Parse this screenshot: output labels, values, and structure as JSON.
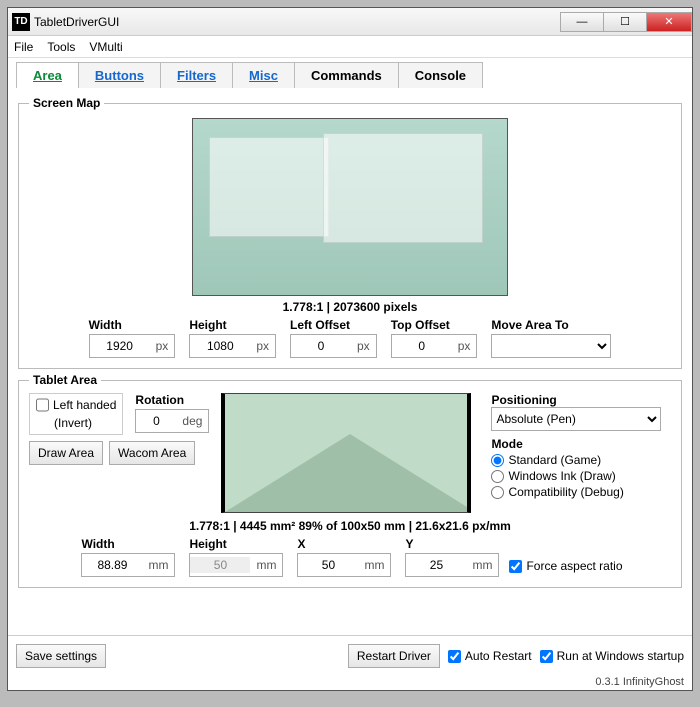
{
  "titlebar": {
    "icon": "TD",
    "title": "TabletDriverGUI"
  },
  "menu": {
    "file": "File",
    "tools": "Tools",
    "vmulti": "VMulti"
  },
  "tabs": {
    "area": "Area",
    "buttons": "Buttons",
    "filters": "Filters",
    "misc": "Misc",
    "commands": "Commands",
    "console": "Console"
  },
  "screenmap": {
    "legend": "Screen Map",
    "caption": "1.778:1 | 2073600 pixels",
    "width_label": "Width",
    "width": "1920",
    "width_unit": "px",
    "height_label": "Height",
    "height": "1080",
    "height_unit": "px",
    "left_label": "Left Offset",
    "left": "0",
    "left_unit": "px",
    "top_label": "Top Offset",
    "top": "0",
    "top_unit": "px",
    "move_label": "Move Area To",
    "move_value": ""
  },
  "tabletarea": {
    "legend": "Tablet Area",
    "lefthand_label": "Left handed",
    "lefthand_sub": "(Invert)",
    "rotation_label": "Rotation",
    "rotation": "0",
    "rotation_unit": "deg",
    "draw_btn": "Draw Area",
    "wacom_btn": "Wacom Area",
    "positioning_label": "Positioning",
    "positioning_value": "Absolute (Pen)",
    "mode_label": "Mode",
    "mode1": "Standard (Game)",
    "mode2": "Windows Ink (Draw)",
    "mode3": "Compatibility (Debug)",
    "caption": "1.778:1 | 4445 mm² 89% of 100x50 mm | 21.6x21.6 px/mm",
    "w_label": "Width",
    "w": "88.89",
    "w_unit": "mm",
    "h_label": "Height",
    "h": "50",
    "h_unit": "mm",
    "x_label": "X",
    "x": "50",
    "x_unit": "mm",
    "y_label": "Y",
    "y": "25",
    "y_unit": "mm",
    "force_label": "Force aspect ratio"
  },
  "footer": {
    "save": "Save settings",
    "restart": "Restart Driver",
    "auto": "Auto Restart",
    "startup": "Run at Windows startup"
  },
  "version": "0.3.1 InfinityGhost"
}
